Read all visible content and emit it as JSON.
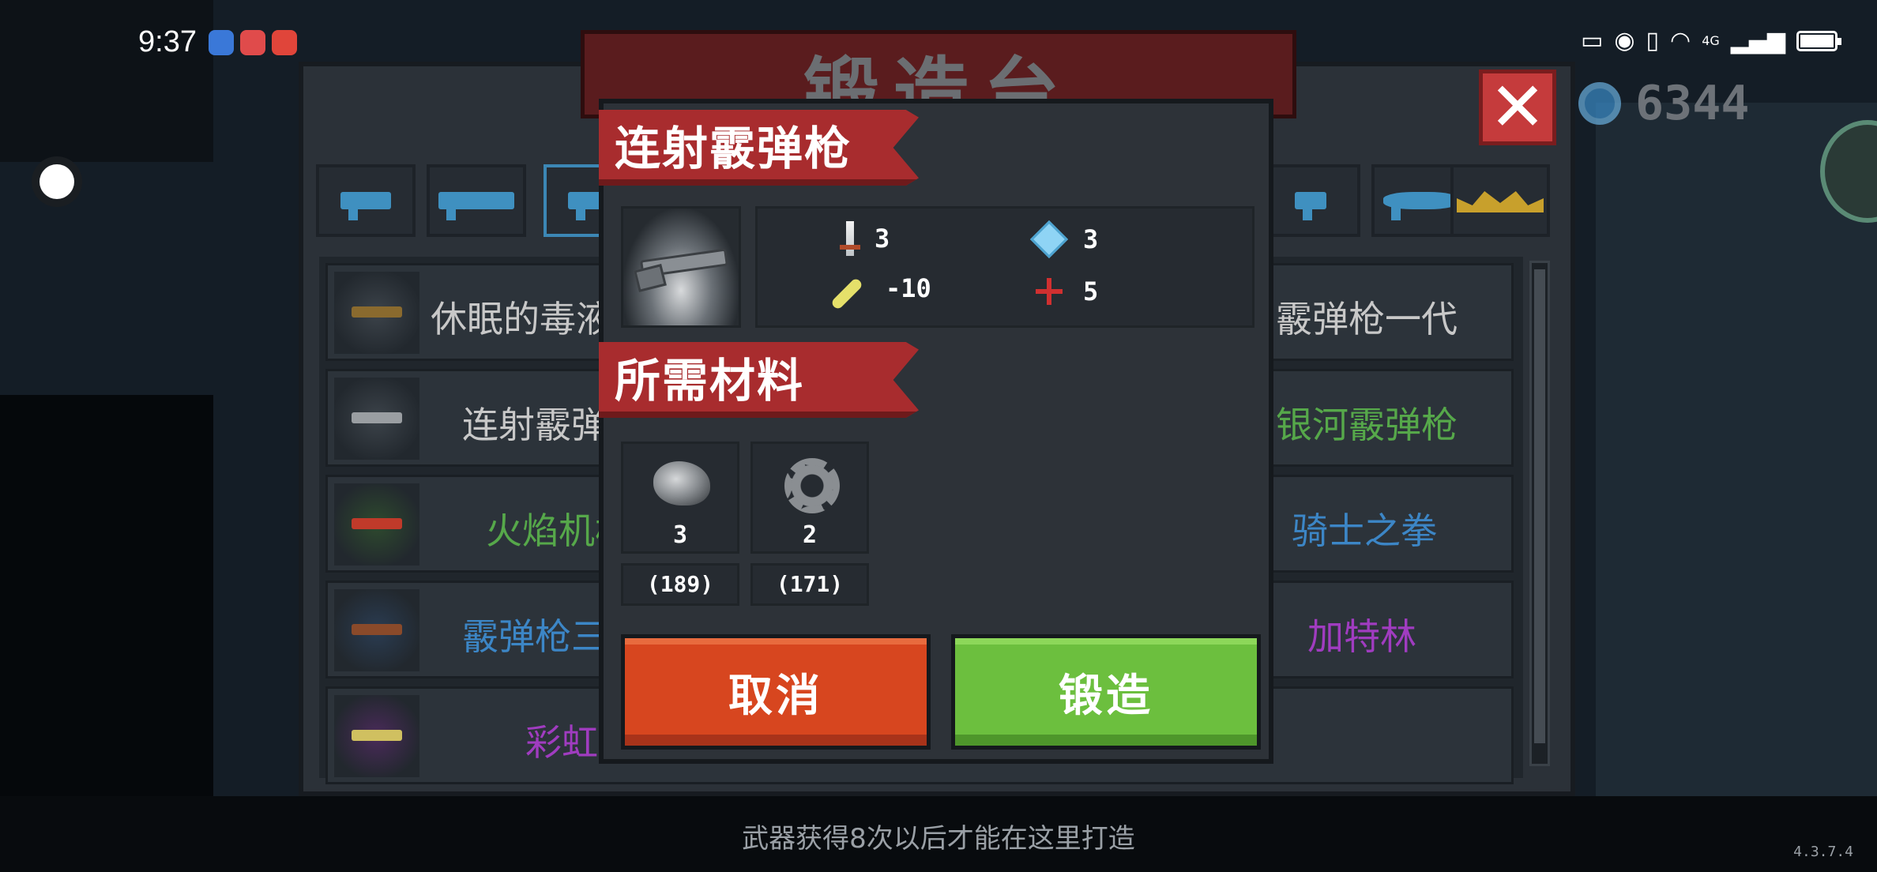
{
  "status_bar": {
    "time": "9:37",
    "network_label": "4G"
  },
  "forge": {
    "title": "锻造台",
    "close_label": "✕",
    "currency_value": "6344"
  },
  "category_tabs": [
    {
      "icon": "pistol-icon"
    },
    {
      "icon": "rifle-icon"
    },
    {
      "icon": "shotgun-icon",
      "active": true
    },
    {
      "icon": "launcher-icon"
    },
    {
      "icon": "fish-icon"
    },
    {
      "icon": "crown-icon"
    }
  ],
  "weapon_list": {
    "left": [
      {
        "name": "休眠的毒液",
        "color": "#c8c8c8"
      },
      {
        "name": "连射霰弹枪",
        "color": "#c8c8c8"
      },
      {
        "name": "火焰机枪",
        "color": "#56a84a"
      },
      {
        "name": "霰弹枪三代",
        "color": "#3c86c6"
      },
      {
        "name": "彩虹",
        "color": "#a03cc0"
      }
    ],
    "right": [
      {
        "name": "霰弹枪一代",
        "color": "#c8c8c8"
      },
      {
        "name": "银河霰弹枪",
        "color": "#56a84a"
      },
      {
        "name": "骑士之拳",
        "color": "#3c86c6"
      },
      {
        "name": "加特林",
        "color": "#a03cc0"
      }
    ]
  },
  "detail": {
    "weapon_name": "连射霰弹枪",
    "stats": {
      "damage": "3",
      "energy": "3",
      "accuracy": "-10",
      "crit": "5"
    },
    "materials_title": "所需材料",
    "materials": [
      {
        "icon": "ore-icon",
        "required": "3",
        "owned": "(189)"
      },
      {
        "icon": "gear-icon",
        "required": "2",
        "owned": "(171)"
      }
    ],
    "cancel_label": "取消",
    "forge_label": "锻造"
  },
  "footer_hint": "武器获得8次以后才能在这里打造",
  "version": "4.3.7.4"
}
